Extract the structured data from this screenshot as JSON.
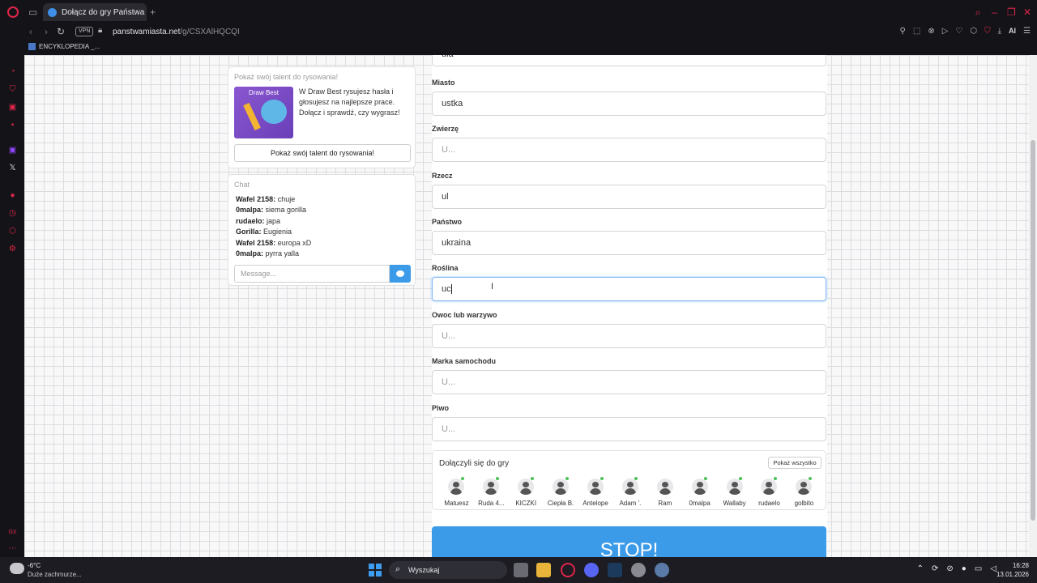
{
  "browser": {
    "tab_title": "Dołącz do gry Państwa Mi...",
    "new_tab": "+",
    "vpn": "VPN",
    "url_host": "panstwamiasta.net",
    "url_path": "/g/CSXAlHQCQI",
    "ai_label": "AI",
    "bookmark": "ENCYKLOPEDIA _..."
  },
  "draw_best": {
    "heading": "Pokaż swój talent do rysowania!",
    "thumb_title": "Draw Best",
    "description": "W Draw Best rysujesz hasła i głosujesz na najlepsze prace. Dołącz i sprawdź, czy wygrasz!",
    "button": "Pokaż swój talent do rysowania!"
  },
  "chat": {
    "heading": "Chat",
    "messages": [
      {
        "user": "Wafel 2158:",
        "text": " chuje"
      },
      {
        "user": "0malpa:",
        "text": " siema gorilla"
      },
      {
        "user": "rudaelo:",
        "text": " japa"
      },
      {
        "user": "Gorilla:",
        "text": " Eugienia"
      },
      {
        "user": "Wafel 2158:",
        "text": " europa xD"
      },
      {
        "user": "0malpa:",
        "text": " pyrra yalla"
      }
    ],
    "input_placeholder": "Message..."
  },
  "form": {
    "partial_top_value": "ula",
    "fields": [
      {
        "label": "Miasto",
        "value": "ustka",
        "placeholder": "U..."
      },
      {
        "label": "Zwierzę",
        "value": "",
        "placeholder": "U..."
      },
      {
        "label": "Rzecz",
        "value": "ul",
        "placeholder": "U..."
      },
      {
        "label": "Państwo",
        "value": "ukraina",
        "placeholder": "U..."
      },
      {
        "label": "Roślina",
        "value": "uc",
        "placeholder": "U..."
      },
      {
        "label": "Owoc lub warzywo",
        "value": "",
        "placeholder": "U..."
      },
      {
        "label": "Marka samochodu",
        "value": "",
        "placeholder": "U..."
      },
      {
        "label": "Piwo",
        "value": "",
        "placeholder": "U..."
      }
    ]
  },
  "players": {
    "heading": "Dołączyli się do gry",
    "show_all": "Pokaż wszystko",
    "list": [
      "Matuesz",
      "Ruda 4...",
      "KICZKI",
      "Ciepła B.",
      "Antelope",
      "Adam '.",
      "Ram",
      "0malpa",
      "Wallaby",
      "rudaelo",
      "golbito"
    ]
  },
  "stop_button": "STOP!",
  "taskbar": {
    "temperature": "-6°C",
    "weather": "Duże zachmurze...",
    "search": "Wyszukaj",
    "time": "16:28",
    "date": "13.01.2026"
  },
  "colors": {
    "accent": "#3c9be8",
    "opera_red": "#e0254a",
    "online": "#4cc25a"
  }
}
